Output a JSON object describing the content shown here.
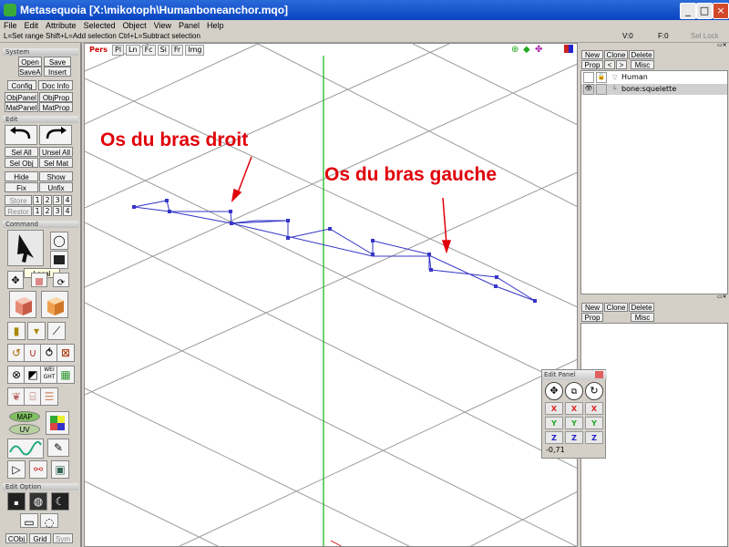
{
  "window": {
    "title": "Metasequoia [X:\\mikotoph\\Humanboneanchor.mqo]"
  },
  "menu": [
    "File",
    "Edit",
    "Attribute",
    "Selected",
    "Object",
    "View",
    "Panel",
    "Help"
  ],
  "hint": {
    "text": "L=Set range  Shift+L=Add selection  Ctrl+L=Subtract selection",
    "v": "V:0",
    "f": "F:0",
    "select_lock": "Sel Lock"
  },
  "left": {
    "system_label": "System",
    "open": "Open",
    "save": "Save",
    "saveas": "SaveAs",
    "insert": "Insert",
    "config": "Config",
    "docinfo": "Doc Info",
    "objpanel": "ObjPanel",
    "objprop": "ObjProp",
    "matpanel": "MatPanel",
    "matprop": "MatProp",
    "edit_label": "Edit",
    "selall": "Sel All",
    "unselall": "Unsel All",
    "selobj": "Sel Obj",
    "selmat": "Sel Mat",
    "hide": "Hide",
    "show": "Show",
    "fix": "Fix",
    "unfix": "Unfix",
    "store": "Store",
    "restore": "Restor",
    "nums": [
      "1",
      "2",
      "3",
      "4"
    ],
    "command_label": "Command",
    "local_tooltip": "Local",
    "map": "MAP",
    "uv": "UV",
    "wei": "WEI GHT",
    "editoption_label": "Edit Option",
    "cobj": "CObj",
    "grid": "Grid",
    "sym": "Sym"
  },
  "viewport": {
    "tabs": [
      "Pers",
      "Pl",
      "Ln",
      "Fc",
      "Si",
      "Fr",
      "Img"
    ],
    "annotation_right": "Os du bras droit",
    "annotation_left": "Os du bras gauche",
    "colors": {
      "bone": "#3535c8",
      "grid": "#9a9a9a",
      "axis": "#22bb22",
      "annot": "#e0000a"
    }
  },
  "objects": {
    "new": "New",
    "clone": "Clone",
    "delete": "Delete",
    "prop": "Prop",
    "lt": "<",
    "gt": ">",
    "misc": "Misc",
    "items": [
      {
        "name": "Human"
      },
      {
        "name": "bone:squelette"
      }
    ]
  },
  "materials": {
    "new": "New",
    "clone": "Clone",
    "delete": "Delete",
    "prop": "Prop",
    "misc": "Misc"
  },
  "editpanel": {
    "title": "Edit Panel",
    "x": "X",
    "y": "Y",
    "z": "Z",
    "value": "-0,71"
  }
}
